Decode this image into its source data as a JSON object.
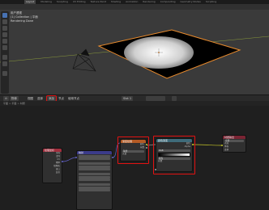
{
  "topbar": {
    "menu": [
      "Layout",
      "Modeling",
      "Sculpting",
      "UV Editing",
      "Texture Paint",
      "Shading",
      "Animation",
      "Rendering",
      "Compositing",
      "Geometry Nodes",
      "Scripting"
    ],
    "active_index": 0
  },
  "viewport": {
    "overlay": [
      "用户透视",
      "(1) Collection | 平面",
      "Rendering Done"
    ]
  },
  "node_header": {
    "items": [
      "物体",
      "视图",
      "选择",
      "添加",
      "节点",
      "使用节点"
    ],
    "highlight": "添加",
    "slot": "Slot 1"
  },
  "node_sub": {
    "breadcrumb": "平面 > 平面 > 材质"
  },
  "nodes": {
    "texcoord": {
      "title": "纹理坐标",
      "rows": [
        "生成",
        "法向",
        "UV",
        "物体",
        "摄像机",
        "窗口",
        "反射"
      ]
    },
    "mapping": {
      "title": "映射"
    },
    "gradient": {
      "title": "渐变纹理",
      "rows": [
        "颜色",
        "系数",
        "球状",
        "矢量"
      ]
    },
    "ramp": {
      "title": "颜色渐变",
      "rows": [
        "颜色",
        "Alpha",
        "RGB",
        "线性",
        "系数"
      ]
    },
    "output": {
      "title": "材质输出",
      "rows": [
        "全部",
        "表面",
        "体积",
        "置换"
      ]
    }
  },
  "colors": {
    "selection_highlight": "#e31212",
    "selected_object_outline": "#e88a2c",
    "active_tool": "#4772b3"
  }
}
